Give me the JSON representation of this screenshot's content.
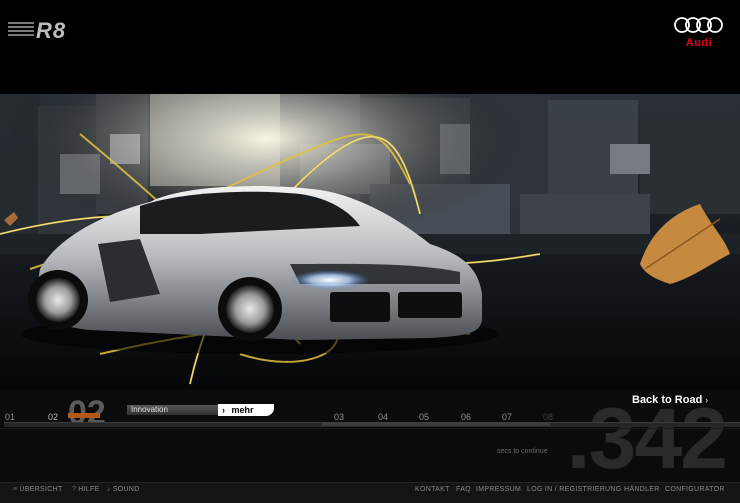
{
  "header": {
    "r8_logo_text": "R8",
    "audi_logo_text": "Audi"
  },
  "panel": {
    "back_to_road": "Back to Road",
    "back_arrow": "›",
    "chapters": [
      "01",
      "02",
      "03",
      "04",
      "05",
      "06",
      "07",
      "08"
    ],
    "current_chapter_big": "02",
    "innovation_label": "Innovation",
    "mehr_label": "mehr",
    "mehr_arrow": "›",
    "secs_label": "secs to continue",
    "countdown": ".342",
    "progress_fraction": 0.31
  },
  "footer": {
    "left": [
      {
        "icon": "overview-icon",
        "glyph": "≡",
        "label": "ÜBERSICHT"
      },
      {
        "icon": "help-icon",
        "glyph": "?",
        "label": "HILFE"
      },
      {
        "icon": "sound-icon",
        "glyph": "♪",
        "label": "SOUND"
      }
    ],
    "right": [
      "KONTAKT",
      "FAQ",
      "IMPRESSUM",
      "LOG IN / REGISTRIERUNG",
      "HÄNDLER",
      "CONFIGURATOR"
    ]
  },
  "colors": {
    "audi_red": "#e3001b",
    "orange_accent": "#b35a1a",
    "light_trail": "#e2c23a"
  }
}
